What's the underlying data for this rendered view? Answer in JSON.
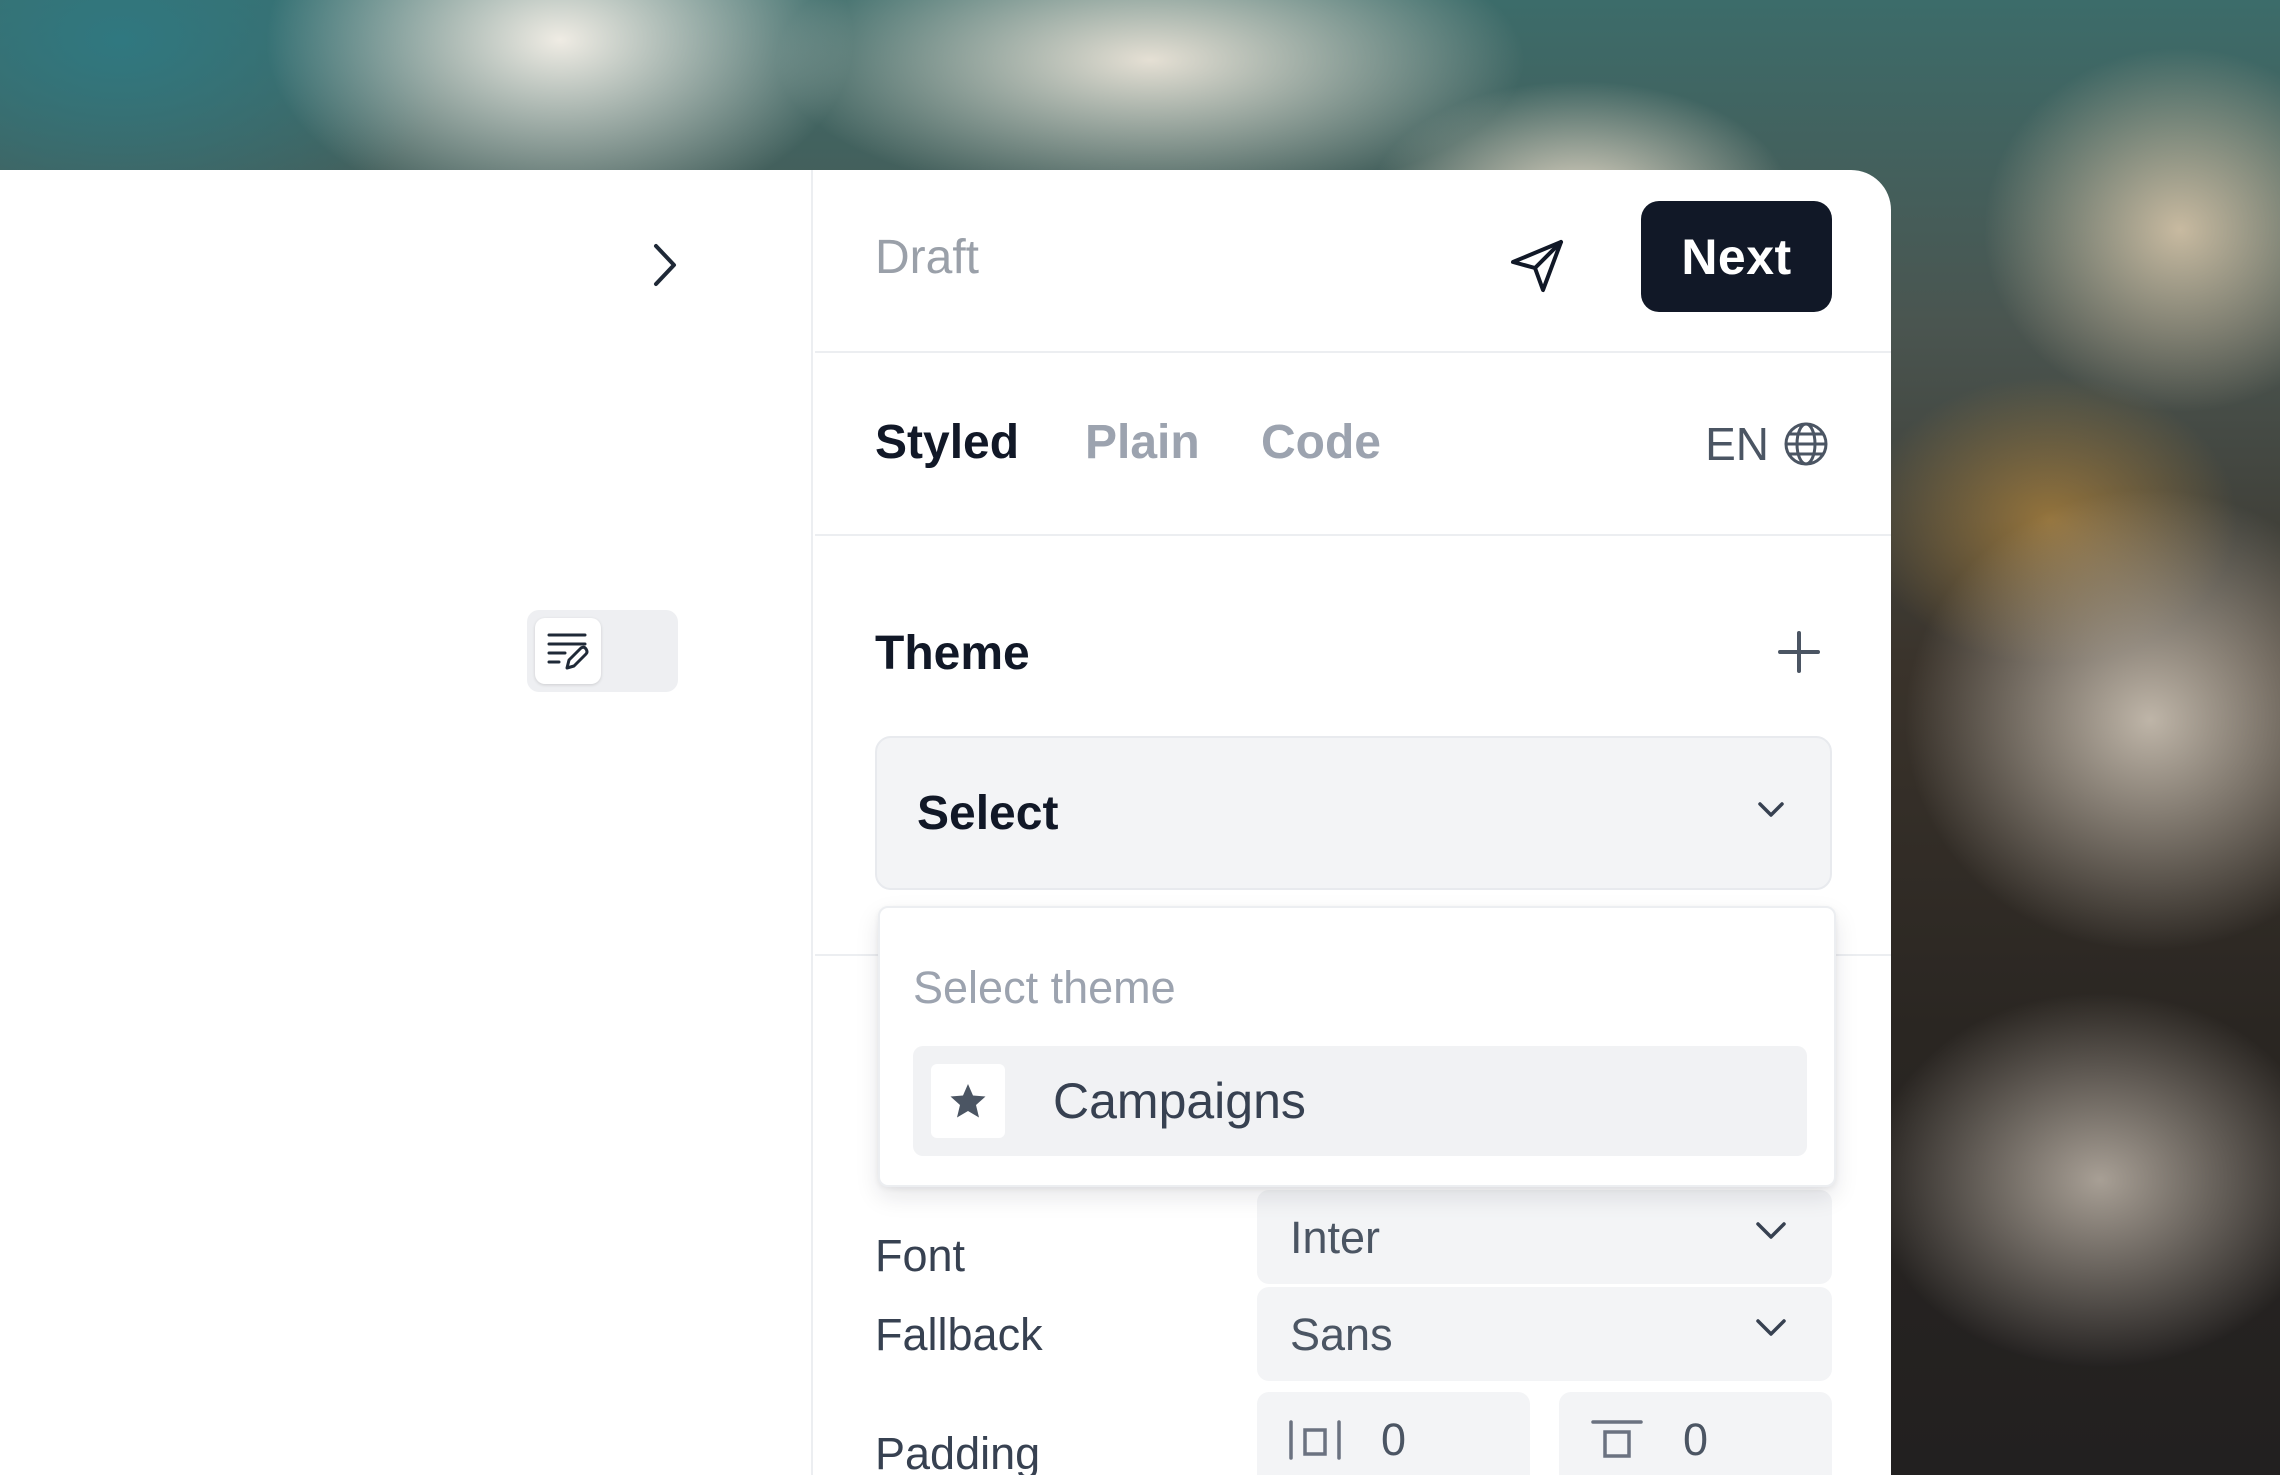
{
  "header": {
    "status": "Draft",
    "next_label": "Next"
  },
  "tabs": [
    {
      "label": "Styled",
      "active": true
    },
    {
      "label": "Plain",
      "active": false
    },
    {
      "label": "Code",
      "active": false
    }
  ],
  "language": {
    "code": "EN",
    "icon": "globe-icon"
  },
  "theme": {
    "title": "Theme",
    "select_value": "Select",
    "popover": {
      "heading": "Select theme",
      "options": [
        {
          "label": "Campaigns",
          "icon": "star-icon"
        }
      ]
    }
  },
  "typography": {
    "font_label": "Font",
    "font_value": "Inter",
    "fallback_label": "Fallback",
    "fallback_value": "Sans",
    "padding_label": "Padding",
    "padding_horizontal": "0",
    "padding_vertical": "0"
  },
  "colors": {
    "primary": "#111827",
    "muted_text": "#9ca3af",
    "field_bg": "#f3f4f6"
  }
}
